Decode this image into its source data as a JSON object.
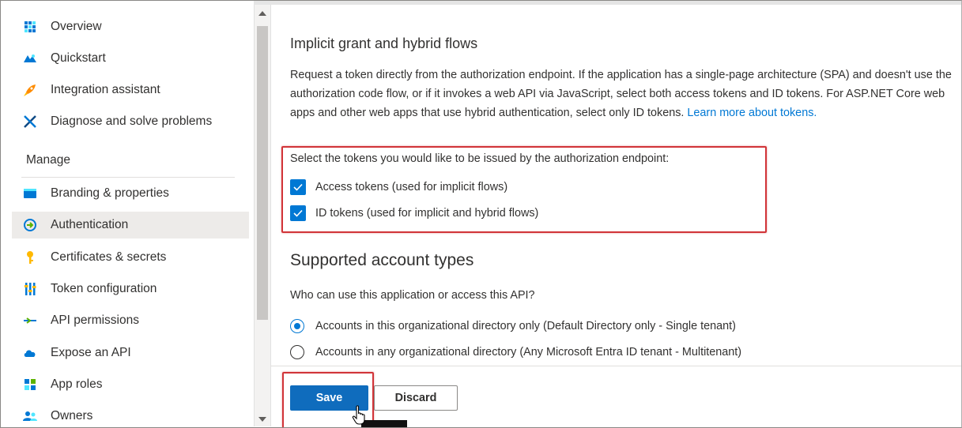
{
  "sidebar": {
    "items": [
      {
        "label": "Overview",
        "icon": "overview-icon"
      },
      {
        "label": "Quickstart",
        "icon": "quickstart-icon"
      },
      {
        "label": "Integration assistant",
        "icon": "rocket-icon"
      },
      {
        "label": "Diagnose and solve problems",
        "icon": "wrench-icon"
      }
    ],
    "section": "Manage",
    "manage_items": [
      {
        "label": "Branding & properties",
        "icon": "branding-icon"
      },
      {
        "label": "Authentication",
        "icon": "authentication-icon",
        "active": true
      },
      {
        "label": "Certificates & secrets",
        "icon": "key-icon"
      },
      {
        "label": "Token configuration",
        "icon": "token-config-icon"
      },
      {
        "label": "API permissions",
        "icon": "api-permissions-icon"
      },
      {
        "label": "Expose an API",
        "icon": "cloud-icon"
      },
      {
        "label": "App roles",
        "icon": "app-roles-icon"
      },
      {
        "label": "Owners",
        "icon": "owners-icon"
      }
    ]
  },
  "main": {
    "implicit_title": "Implicit grant and hybrid flows",
    "implicit_desc": "Request a token directly from the authorization endpoint. If the application has a single-page architecture (SPA) and doesn't use the authorization code flow, or if it invokes a web API via JavaScript, select both access tokens and ID tokens. For ASP.NET Core web apps and other web apps that use hybrid authentication, select only ID tokens.",
    "learn_more": "Learn more about tokens.",
    "token_prompt": "Select the tokens you would like to be issued by the authorization endpoint:",
    "access_tokens": {
      "label": "Access tokens (used for implicit flows)",
      "checked": true
    },
    "id_tokens": {
      "label": "ID tokens (used for implicit and hybrid flows)",
      "checked": true
    },
    "accounts_title": "Supported account types",
    "accounts_question": "Who can use this application or access this API?",
    "account_options": [
      {
        "label": "Accounts in this organizational directory only (Default Directory only - Single tenant)",
        "selected": true
      },
      {
        "label": "Accounts in any organizational directory (Any Microsoft Entra ID tenant - Multitenant)",
        "selected": false
      }
    ],
    "save_label": "Save",
    "discard_label": "Discard"
  },
  "colors": {
    "accent": "#0078d4",
    "highlight": "#d13438"
  }
}
